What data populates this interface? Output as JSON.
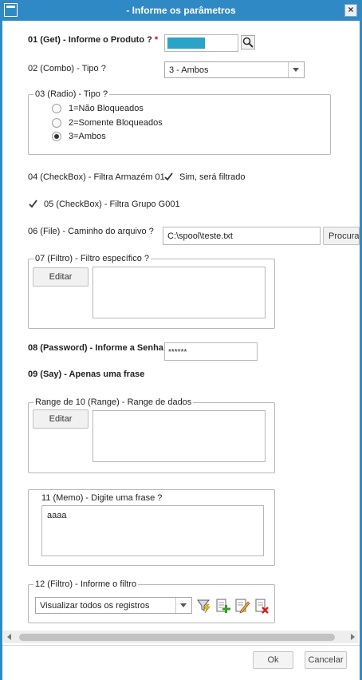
{
  "window": {
    "title": "- Informe os parâmetros"
  },
  "fields": {
    "produto": {
      "label": "01 (Get) - Informe o Produto ?",
      "required_mark": "*"
    },
    "tipo_combo": {
      "label": "02 (Combo) - Tipo ?",
      "value": "3 - Ambos"
    },
    "tipo_radio": {
      "label": "03 (Radio) - Tipo ?",
      "options": [
        "1=Não Bloqueados",
        "2=Somente Bloqueados",
        "3=Ambos"
      ],
      "selected": "3=Ambos"
    },
    "armazem": {
      "label": "04 (CheckBox) - Filtra Armazém 01",
      "check_label": "Sim, será filtrado",
      "checked": true
    },
    "grupo": {
      "label": "05 (CheckBox) - Filtra Grupo G001",
      "checked": true
    },
    "arquivo": {
      "label": "06 (File) - Caminho do arquivo ?",
      "value": "C:\\spool\\teste.txt",
      "button": "Procura"
    },
    "filtro_especifico": {
      "label": "07 (Filtro) - Filtro específico ?",
      "button": "Editar"
    },
    "senha": {
      "label": "08 (Password) - Informe a Senha",
      "value": "******"
    },
    "say": {
      "label": "09 (Say) - Apenas uma frase"
    },
    "range": {
      "label": "Range de 10 (Range) - Range de dados",
      "button": "Editar"
    },
    "memo": {
      "label": "11 (Memo) - Digite uma frase ?",
      "value": "aaaa"
    },
    "filtro": {
      "label": "12 (Filtro) - Informe o filtro",
      "value": "Visualizar todos os registros"
    }
  },
  "footer": {
    "ok": "Ok",
    "cancel": "Cancelar"
  },
  "colors": {
    "titlebar": "#2f89c5",
    "required": "#dd0000",
    "product_fill": "#2aa3c9"
  },
  "icons": [
    "window-menu-icon",
    "close-icon",
    "lookup-search-icon",
    "filter-lightning-icon",
    "add-filter-icon",
    "edit-filter-icon",
    "delete-filter-icon"
  ]
}
